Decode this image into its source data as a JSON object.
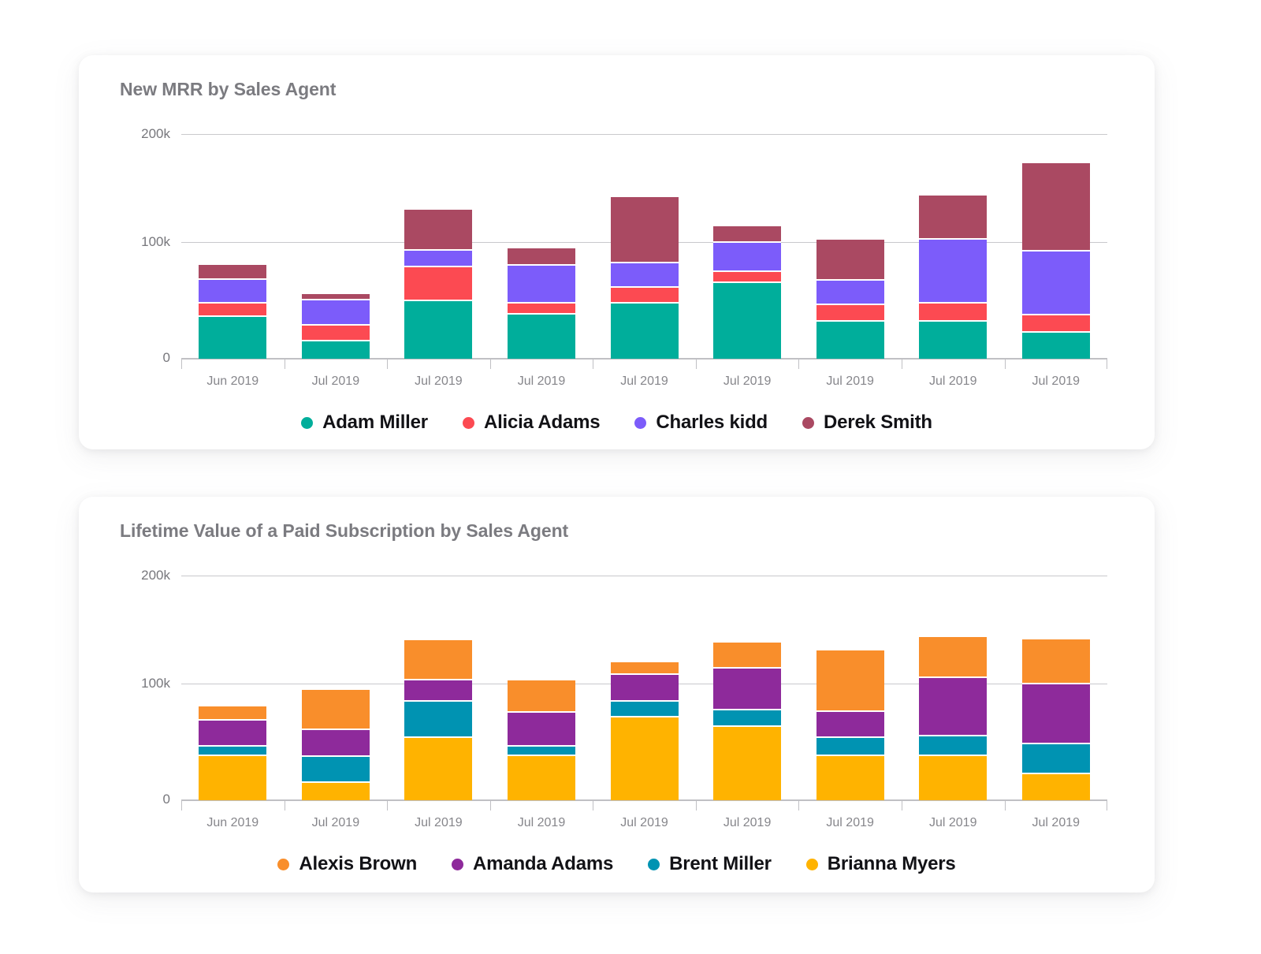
{
  "cards": [
    {
      "id": "mrr",
      "title": "New MRR by Sales Agent"
    },
    {
      "id": "ltv",
      "title": "Lifetime Value of a Paid Subscription by Sales Agent"
    }
  ],
  "axis": {
    "y_ticks": [
      "200k",
      "100k",
      "0"
    ],
    "y_tick_values": [
      200000,
      100000,
      0
    ]
  },
  "chart_data": [
    {
      "id": "mrr",
      "type": "bar",
      "stacked": true,
      "title": "New MRR by Sales Agent",
      "xlabel": "",
      "ylabel": "",
      "ylim": [
        0,
        209000
      ],
      "grid": "horizontal",
      "legend_position": "bottom",
      "categories": [
        "Jun 2019",
        "Jul 2019",
        "Jul 2019",
        "Jul 2019",
        "Jul 2019",
        "Jul 2019",
        "Jul 2019",
        "Jul 2019",
        "Jul 2019"
      ],
      "ytick_labels": [
        "200k",
        "100k",
        "0"
      ],
      "ytick_values": [
        200000,
        100000,
        0
      ],
      "series": [
        {
          "name": "Adam Miller",
          "color": "#00ae9b",
          "values": [
            39000,
            16000,
            53000,
            41000,
            51000,
            70000,
            34000,
            34000,
            24000
          ]
        },
        {
          "name": "Alicia Adams",
          "color": "#fc4a52",
          "values": [
            12000,
            15000,
            32000,
            10000,
            15000,
            10000,
            16000,
            17000,
            16000
          ]
        },
        {
          "name": "Charles kidd",
          "color": "#7c5cfa",
          "values": [
            22000,
            23000,
            15000,
            35000,
            22000,
            27000,
            22000,
            59000,
            59000
          ]
        },
        {
          "name": "Derek Smith",
          "color": "#aa4962",
          "values": [
            14000,
            6000,
            38000,
            16000,
            62000,
            16000,
            38000,
            41000,
            82000
          ]
        }
      ]
    },
    {
      "id": "ltv",
      "type": "bar",
      "stacked": true,
      "title": "Lifetime Value of a Paid Subscription by Sales Agent",
      "xlabel": "",
      "ylabel": "",
      "ylim": [
        0,
        209000
      ],
      "grid": "horizontal",
      "legend_position": "bottom",
      "categories": [
        "Jun 2019",
        "Jul 2019",
        "Jul 2019",
        "Jul 2019",
        "Jul 2019",
        "Jul 2019",
        "Jul 2019",
        "Jul 2019",
        "Jul 2019"
      ],
      "ytick_labels": [
        "200k",
        "100k",
        "0"
      ],
      "ytick_values": [
        200000,
        100000,
        0
      ],
      "series": [
        {
          "name": "Brianna Myers",
          "color": "#ffb300",
          "values": [
            41000,
            16000,
            58000,
            41000,
            77000,
            68000,
            41000,
            41000,
            24000
          ]
        },
        {
          "name": "Brent Miller",
          "color": "#0093b2",
          "values": [
            9000,
            24000,
            33000,
            9000,
            14000,
            15000,
            17000,
            18000,
            28000
          ]
        },
        {
          "name": "Amanda Adams",
          "color": "#8e2a9b",
          "values": [
            24000,
            25000,
            20000,
            31000,
            25000,
            39000,
            24000,
            54000,
            55000
          ]
        },
        {
          "name": "Alexis Brown",
          "color": "#f98e2b",
          "values": [
            13000,
            37000,
            37000,
            30000,
            12000,
            24000,
            57000,
            38000,
            42000
          ]
        }
      ]
    }
  ],
  "legends": [
    {
      "id": "mrr",
      "items": [
        {
          "label": "Adam Miller",
          "color": "#00ae9b"
        },
        {
          "label": "Alicia Adams",
          "color": "#fc4a52"
        },
        {
          "label": "Charles kidd",
          "color": "#7c5cfa"
        },
        {
          "label": "Derek Smith",
          "color": "#aa4962"
        }
      ]
    },
    {
      "id": "ltv",
      "items": [
        {
          "label": "Alexis Brown",
          "color": "#f98e2b"
        },
        {
          "label": "Amanda Adams",
          "color": "#8e2a9b"
        },
        {
          "label": "Brent Miller",
          "color": "#0093b2"
        },
        {
          "label": "Brianna Myers",
          "color": "#ffb300"
        }
      ]
    }
  ]
}
